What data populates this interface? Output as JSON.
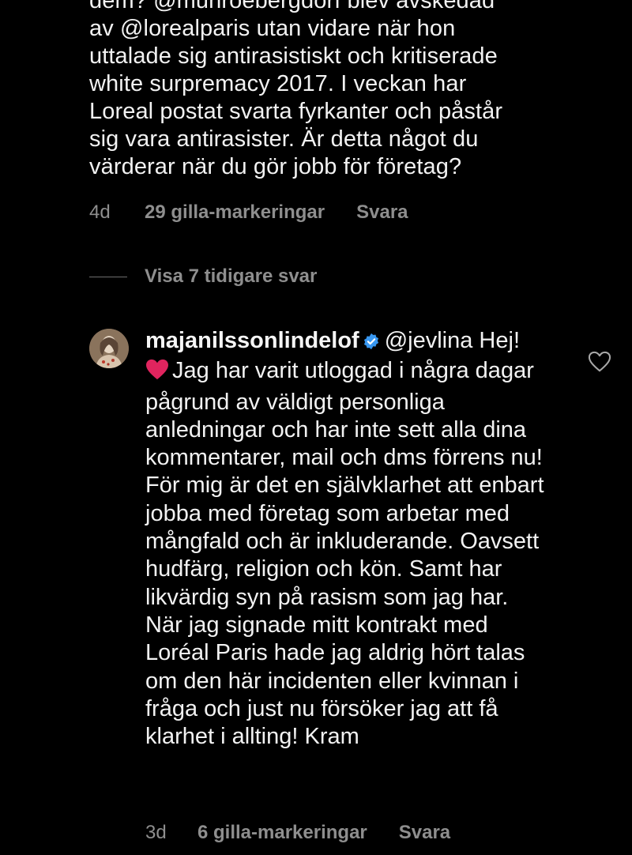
{
  "parent_comment": {
    "text": "dem? @munroebergdorf blev avskedad\nav @lorealparis utan vidare när hon\nuttalade sig antirasistiskt och kritiserade\nwhite surpremacy 2017. I veckan har\nLoreal postat svarta fyrkanter och påstår\nsig vara antirasister. Är detta något du\nvärderar när du gör jobb för företag?",
    "age": "4d",
    "likes": "29 gilla-markeringar",
    "reply_label": "Svara"
  },
  "view_replies_label": "Visa 7 tidigare svar",
  "reply": {
    "username": "majanilssonlindelof",
    "verified_icon": "verified-badge-icon",
    "mention": "@jevlina",
    "greeting": " Hej!",
    "emoji": "red-heart-emoji",
    "paragraph1": "Jag har varit utloggad i några dagar pågrund av väldigt personliga anledningar och har inte sett alla dina kommentarer, mail och dms förrens nu!",
    "paragraph2": "För mig är det en självklarhet att enbart jobba med företag som arbetar med mångfald och är inkluderande. Oavsett hudfärg, religion och kön. Samt har likvärdig syn på rasism som jag har.",
    "paragraph3": "När jag signade mitt kontrakt med Loréal Paris hade jag aldrig hört talas om den här incidenten eller kvinnan i fråga och just nu försöker jag att få klarhet i allting! Kram",
    "age": "3d",
    "likes": "6 gilla-markeringar",
    "reply_label": "Svara",
    "like_icon": "heart-outline-icon"
  },
  "colors": {
    "background": "#000000",
    "text": "#f2f2f2",
    "muted": "#8e8e8e",
    "verified": "#3897f0",
    "heart": "#e0245e"
  }
}
